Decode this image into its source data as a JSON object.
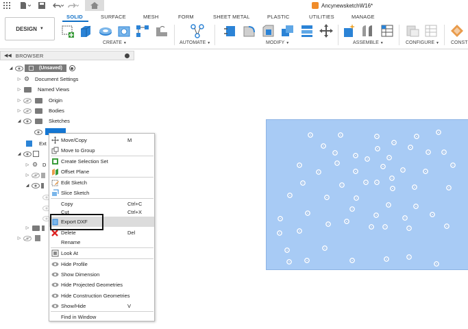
{
  "app": {
    "document_title": "AncynewsketchW16*"
  },
  "ribbon": {
    "workspace_label": "DESIGN",
    "tabs": [
      {
        "label": "SOLID",
        "active": true
      },
      {
        "label": "SURFACE",
        "active": false
      },
      {
        "label": "MESH",
        "active": false
      },
      {
        "label": "FORM",
        "active": false
      },
      {
        "label": "SHEET METAL",
        "active": false
      },
      {
        "label": "PLASTIC",
        "active": false
      },
      {
        "label": "UTILITIES",
        "active": false
      },
      {
        "label": "MANAGE",
        "active": false
      }
    ],
    "groups": [
      "CREATE",
      "AUTOMATE",
      "MODIFY",
      "ASSEMBLE",
      "CONFIGURE",
      "CONST"
    ]
  },
  "browser": {
    "title": "BROWSER",
    "root_label": "(Unsaved)",
    "items": [
      "Document Settings",
      "Named Views",
      "Origin",
      "Bodies",
      "Sketches"
    ],
    "truncated_extrude": "Ext",
    "truncated_d": "D"
  },
  "context_menu": {
    "items": [
      {
        "label": "Move/Copy",
        "shortcut": "M",
        "icon": "move-icon"
      },
      {
        "label": "Move to Group",
        "shortcut": "",
        "icon": "group-icon"
      },
      {
        "label": "Create Selection Set",
        "shortcut": "",
        "icon": "selection-set-icon"
      },
      {
        "label": "Offset Plane",
        "shortcut": "",
        "icon": "offset-plane-icon"
      },
      {
        "label": "Edit Sketch",
        "shortcut": "",
        "icon": "edit-sketch-icon"
      },
      {
        "label": "Slice Sketch",
        "shortcut": "",
        "icon": "slice-sketch-icon"
      },
      {
        "label": "Copy",
        "shortcut": "Ctrl+C",
        "icon": ""
      },
      {
        "label": "Cut",
        "shortcut": "Ctrl+X",
        "icon": ""
      },
      {
        "label": "Export DXF",
        "shortcut": "",
        "icon": "export-dxf-icon"
      },
      {
        "label": "Delete",
        "shortcut": "Del",
        "icon": "delete-icon"
      },
      {
        "label": "Rename",
        "shortcut": "",
        "icon": ""
      },
      {
        "label": "Look At",
        "shortcut": "",
        "icon": "look-at-icon"
      },
      {
        "label": "Hide Profile",
        "shortcut": "",
        "icon": "eye-icon"
      },
      {
        "label": "Show Dimension",
        "shortcut": "",
        "icon": "eye-icon"
      },
      {
        "label": "Hide Projected Geometries",
        "shortcut": "",
        "icon": "eye-icon"
      },
      {
        "label": "Hide Construction Geometries",
        "shortcut": "",
        "icon": "eye-icon"
      },
      {
        "label": "Show/Hide",
        "shortcut": "V",
        "icon": "eye-icon"
      },
      {
        "label": "Find in Window",
        "shortcut": "",
        "icon": ""
      }
    ]
  },
  "colors": {
    "accent": "#0f6fc5",
    "sketch_fill": "#a8cbf5",
    "selection": "#1577d3"
  }
}
